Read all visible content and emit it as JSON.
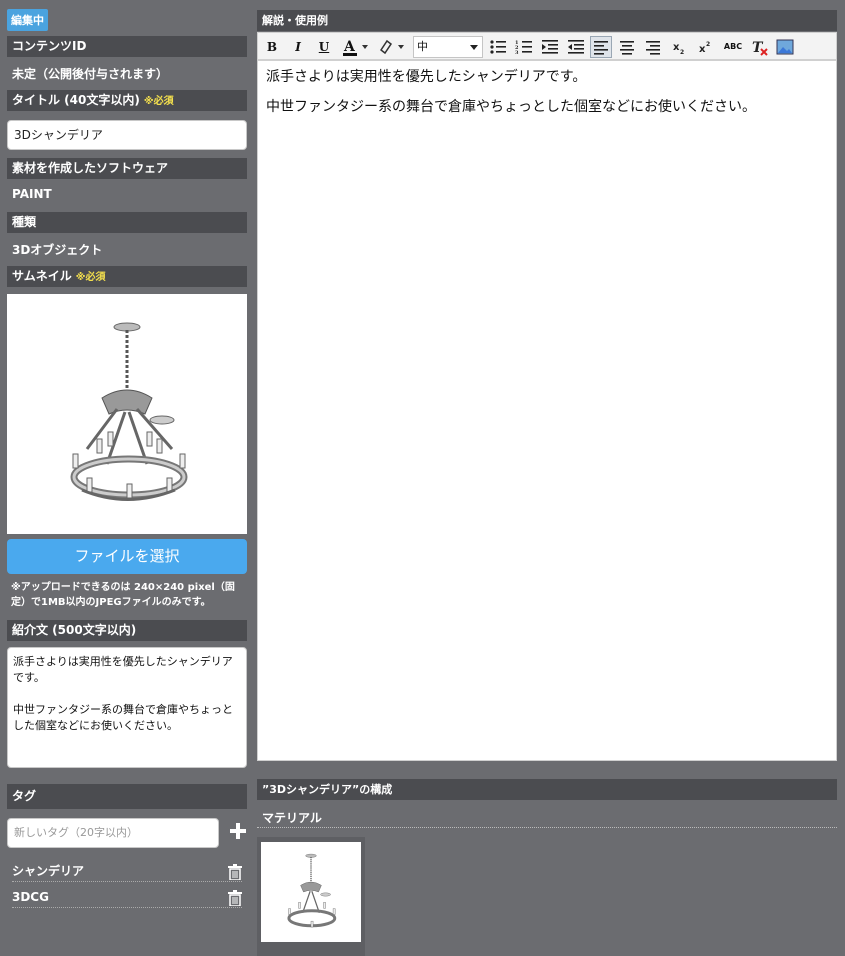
{
  "status_badge": "編集中",
  "left": {
    "content_id_label": "コンテンツID",
    "content_id_value": "未定（公開後付与されます）",
    "title_label": "タイトル (40文字以内)",
    "required": "※必須",
    "title_value": "3Dシャンデリア",
    "software_label": "素材を作成したソフトウェア",
    "software_value": "PAINT",
    "type_label": "種類",
    "type_value": "3Dオブジェクト",
    "thumbnail_label": "サムネイル",
    "file_button": "ファイルを選択",
    "upload_note": "※アップロードできるのは 240×240 pixel（固定）で1MB以内のJPEGファイルのみです。",
    "intro_label": "紹介文 (500文字以内)",
    "intro_value": "派手さよりは実用性を優先したシャンデリアです。\n\n中世ファンタジー系の舞台で倉庫やちょっとした個室などにお使いください。",
    "tags_label": "タグ",
    "tag_placeholder": "新しいタグ（20字以内）",
    "tags": [
      "シャンデリア",
      "3DCG"
    ]
  },
  "right": {
    "desc_label": "解説・使用例",
    "toolbar": {
      "bold": "B",
      "italic": "I",
      "underline": "U",
      "size_value": "中",
      "strike_abc": "ABC"
    },
    "editor_paragraphs": [
      "派手さよりは実用性を優先したシャンデリアです。",
      "中世ファンタジー系の舞台で倉庫やちょっとした個室などにお使いください。"
    ],
    "composition_label": "”3Dシャンデリア”の構成",
    "material_label": "マテリアル"
  },
  "colors": {
    "background": "#6b6c70",
    "section_header": "#4b4c50",
    "accent_blue": "#4aa9ee",
    "required_yellow": "#f4e04d"
  }
}
